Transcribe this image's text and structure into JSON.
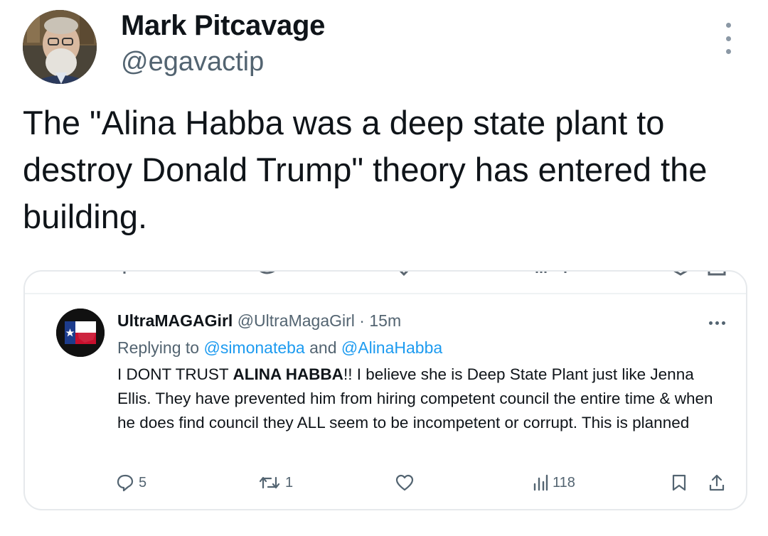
{
  "tweet": {
    "author_name": "Mark Pitcavage",
    "author_handle": "@egavactip",
    "text": "The \"Alina Habba was a deep state plant to destroy Donald Trump\" theory has entered the building.",
    "avatar_icon": "profile-photo-icon",
    "menu_icon": "more-vertical-icon"
  },
  "embedded": {
    "author_name": "UltraMAGAGirl",
    "author_handle": "@UltraMagaGirl",
    "separator": "·",
    "time": "15m",
    "replying_label": "Replying to",
    "reply_to_1": "@simonateba",
    "and_word": "and",
    "reply_to_2": "@AlinaHabba",
    "body_part1": "I DONT TRUST ",
    "body_bold": "ALINA HABBA",
    "body_part2": "!! I believe she is Deep State Plant just like Jenna Ellis. They have prevented him from hiring competent council the entire time & when he does find council they ALL seem to be incompetent or corrupt. This is planned",
    "actions": {
      "replies": "5",
      "retweets": "1",
      "likes": "",
      "views": "118"
    },
    "colors": {
      "link": "#1d9bf0",
      "muted": "#536471"
    }
  }
}
